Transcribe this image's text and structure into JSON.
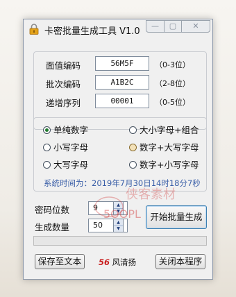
{
  "window": {
    "title": "卡密批量生成工具 V1.0"
  },
  "title_controls": {
    "min": "—",
    "max": "▢",
    "close": "✕"
  },
  "fields": {
    "face_value": {
      "label": "面值编码",
      "value": "56M5F",
      "hint": "（0-3位）"
    },
    "batch": {
      "label": "批次编码",
      "value": "A1B2C",
      "hint": "（2-8位）"
    },
    "sequence": {
      "label": "递增序列",
      "value": "00001",
      "hint": "（0-5位）"
    }
  },
  "options": [
    {
      "label": "单纯数字",
      "selected": true,
      "hover": false
    },
    {
      "label": "大小字母+组合",
      "selected": false,
      "hover": false
    },
    {
      "label": "小写字母",
      "selected": false,
      "hover": false
    },
    {
      "label": "数字+大写字母",
      "selected": false,
      "hover": true
    },
    {
      "label": "大写字母",
      "selected": false,
      "hover": false
    },
    {
      "label": "数字+小写字母",
      "selected": false,
      "hover": false
    }
  ],
  "system_time": "系统时间为：2019年7月30日14时18分7秒",
  "code_digits": {
    "label": "密码位数",
    "value": "9"
  },
  "generate_count": {
    "label": "生成数量",
    "value": "50"
  },
  "buttons": {
    "generate": "开始批量生成",
    "save": "保存至文本",
    "close": "关闭本程序"
  },
  "progress": {
    "fraction": 0
  },
  "brand": {
    "number": "56",
    "name": "风清扬"
  },
  "watermark": {
    "text": "5OOPL",
    "brand_text": "侠客素材",
    "color": "#d23a3a"
  }
}
